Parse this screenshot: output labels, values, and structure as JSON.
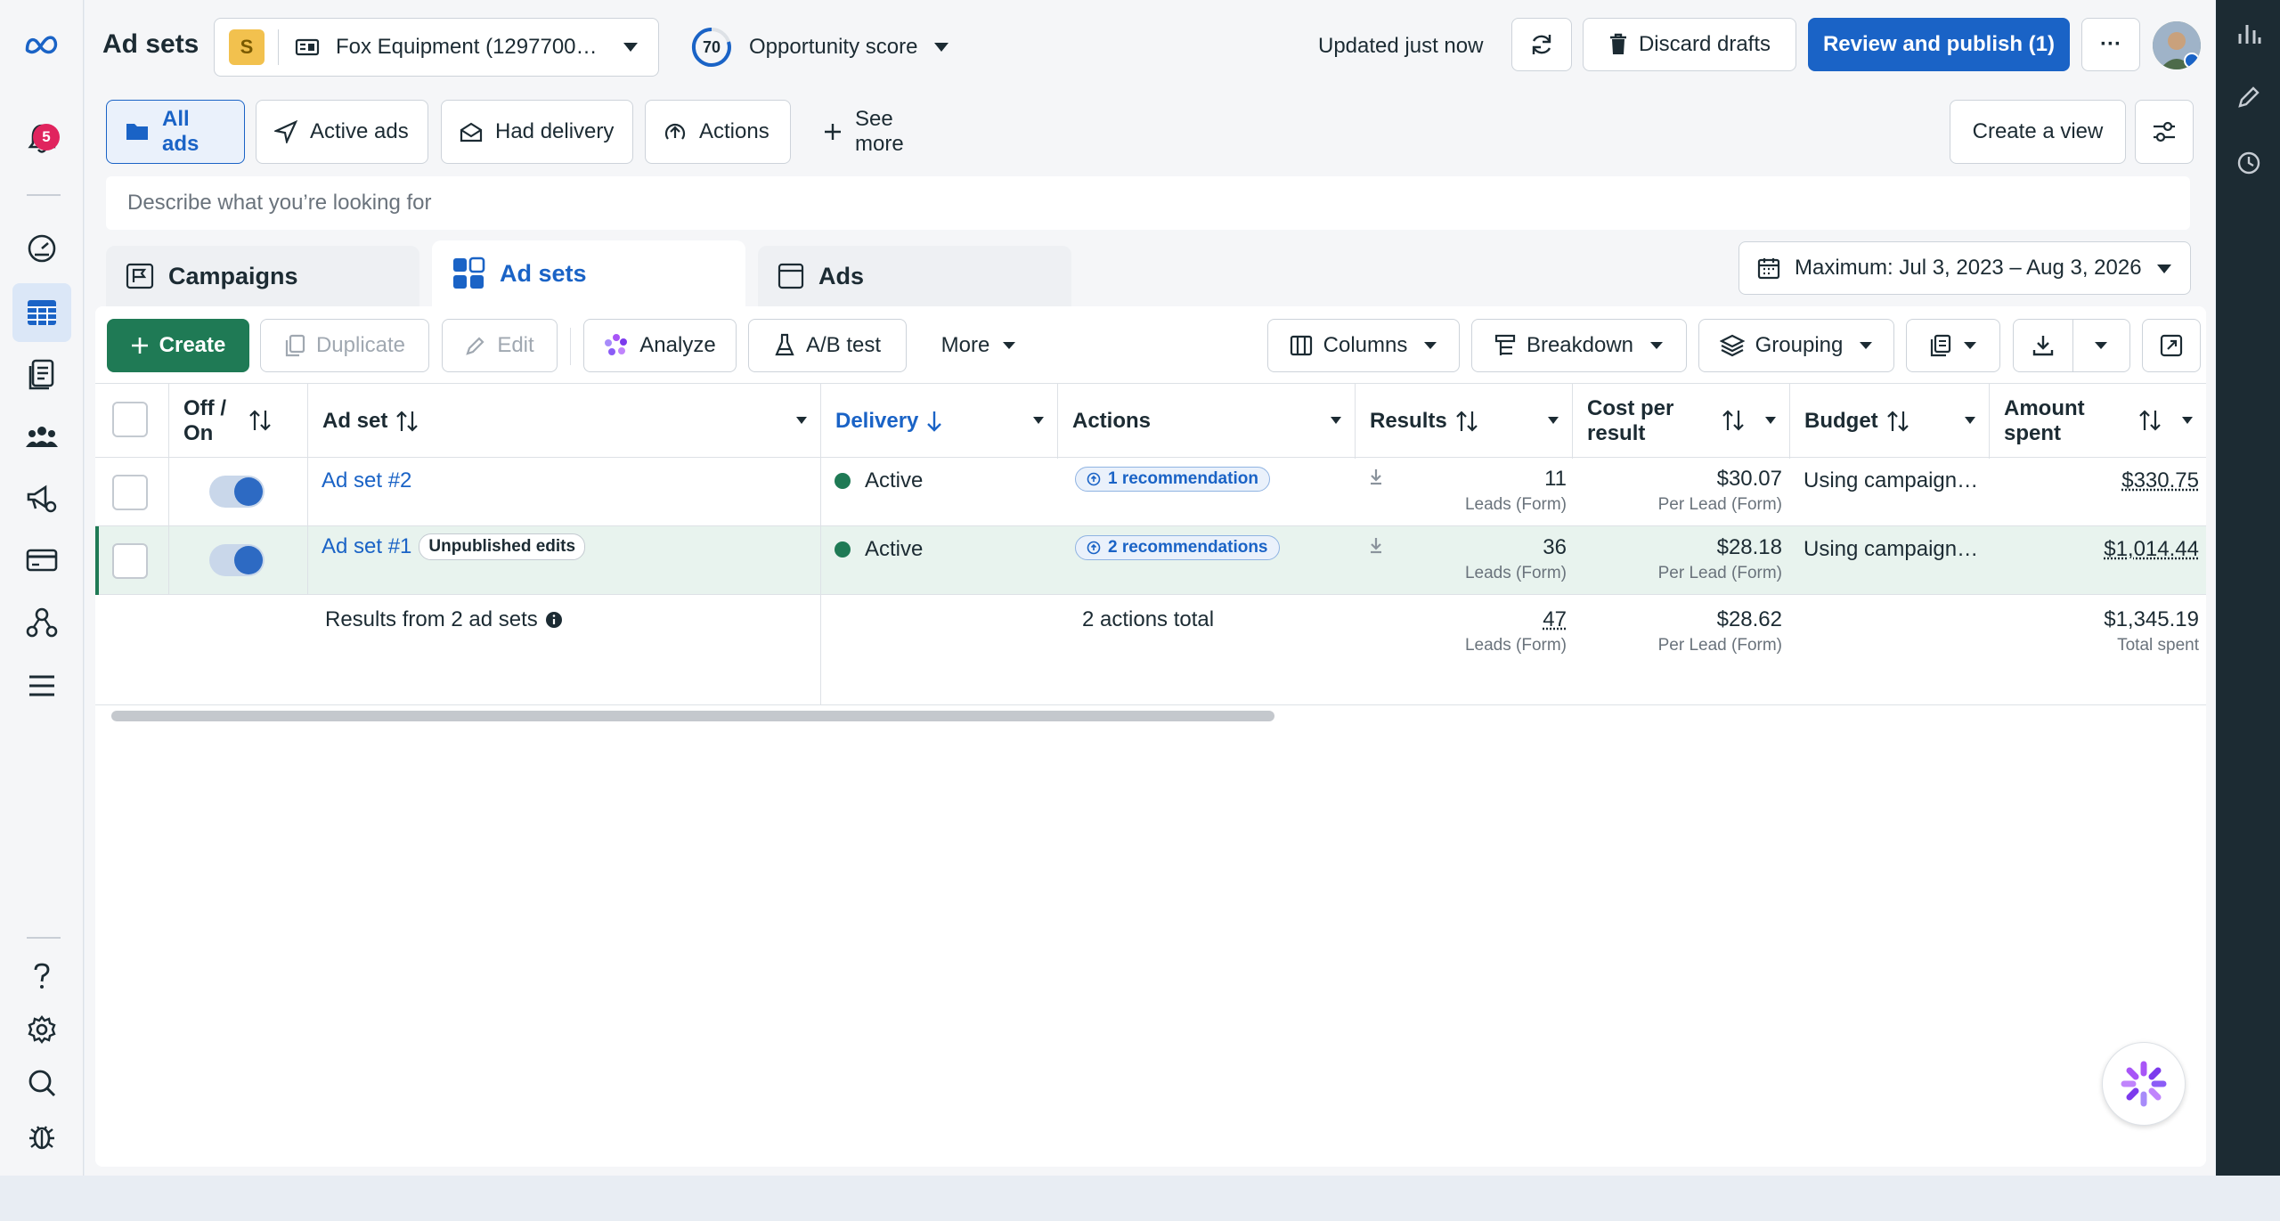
{
  "nav": {
    "notification_count": "5"
  },
  "header": {
    "title": "Ad sets",
    "account_initial": "S",
    "account_name": "Fox Equipment (1297700…",
    "opportunity_value": "70",
    "opportunity_label": "Opportunity score",
    "updated": "Updated just now",
    "discard": "Discard drafts",
    "review": "Review and publish (1)",
    "more_dots": "···"
  },
  "filters": {
    "all_ads": "All ads",
    "active_ads": "Active ads",
    "had_delivery": "Had delivery",
    "actions": "Actions",
    "see_more": "See more",
    "create_view": "Create a view"
  },
  "search": {
    "placeholder": "Describe what you’re looking for"
  },
  "tabs": {
    "campaigns": "Campaigns",
    "ad_sets": "Ad sets",
    "ads": "Ads"
  },
  "date_range": "Maximum: Jul 3, 2023 – Aug 3, 2026",
  "toolbar": {
    "create": "Create",
    "duplicate": "Duplicate",
    "edit": "Edit",
    "analyze": "Analyze",
    "ab_test": "A/B test",
    "more": "More",
    "columns": "Columns",
    "breakdown": "Breakdown",
    "grouping": "Grouping"
  },
  "table": {
    "headers": {
      "offon_1": "Off /",
      "offon_2": "On",
      "ad_set": "Ad set",
      "delivery": "Delivery",
      "actions": "Actions",
      "results": "Results",
      "cost_1": "Cost per",
      "cost_2": "result",
      "budget": "Budget",
      "amount_1": "Amount",
      "amount_2": "spent"
    },
    "rows": [
      {
        "name": "Ad set #2",
        "badge": "",
        "delivery": "Active",
        "actions": "1 recommendation",
        "results": "11",
        "results_sub": "Leads (Form)",
        "cost": "$30.07",
        "cost_sub": "Per Lead (Form)",
        "budget": "Using campaign…",
        "spent": "$330.75"
      },
      {
        "name": "Ad set #1",
        "badge": "Unpublished edits",
        "delivery": "Active",
        "actions": "2 recommendations",
        "results": "36",
        "results_sub": "Leads (Form)",
        "cost": "$28.18",
        "cost_sub": "Per Lead (Form)",
        "budget": "Using campaign…",
        "spent": "$1,014.44"
      }
    ],
    "totals": {
      "label": "Results from 2 ad sets",
      "actions": "2 actions total",
      "results": "47",
      "results_sub": "Leads (Form)",
      "cost": "$28.62",
      "cost_sub": "Per Lead (Form)",
      "spent": "$1,345.19",
      "spent_sub": "Total spent"
    }
  },
  "colors": {
    "accent": "#1a63c6",
    "create_green": "#1f7a55",
    "active_dot": "#1f7a55"
  }
}
